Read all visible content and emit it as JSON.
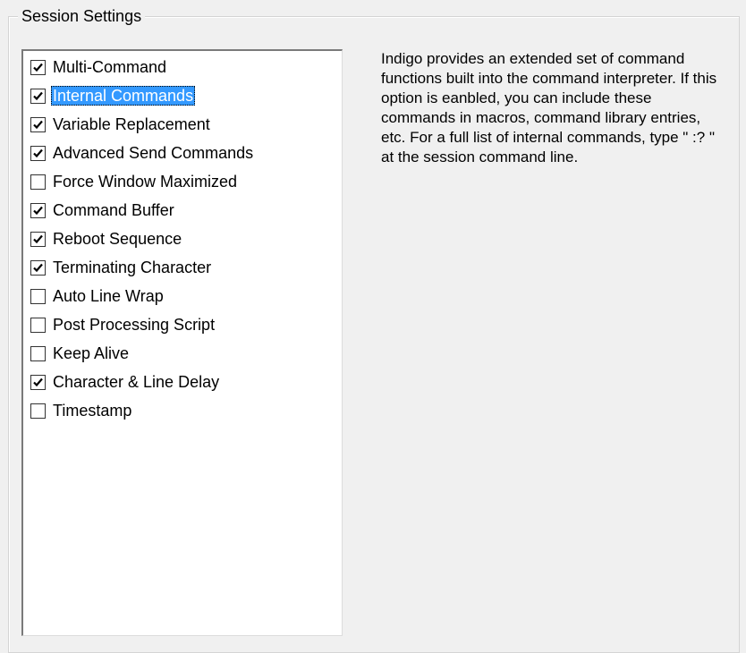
{
  "group_title": "Session Settings",
  "options": [
    {
      "label": "Multi-Command",
      "checked": true
    },
    {
      "label": "Internal Commands",
      "checked": true,
      "selected": true
    },
    {
      "label": "Variable Replacement",
      "checked": true
    },
    {
      "label": "Advanced Send Commands",
      "checked": true
    },
    {
      "label": "Force Window Maximized",
      "checked": false
    },
    {
      "label": "Command Buffer",
      "checked": true
    },
    {
      "label": "Reboot Sequence",
      "checked": true
    },
    {
      "label": "Terminating Character",
      "checked": true
    },
    {
      "label": "Auto Line Wrap",
      "checked": false
    },
    {
      "label": "Post Processing Script",
      "checked": false
    },
    {
      "label": "Keep Alive",
      "checked": false
    },
    {
      "label": "Character & Line Delay",
      "checked": true
    },
    {
      "label": "Timestamp",
      "checked": false
    }
  ],
  "description": "Indigo provides an extended set of command functions built into the command interpreter.  If this option is eanbled, you can include these commands in macros, command library entries, etc.  For a full list of internal commands, type \" :? \" at the session command line."
}
